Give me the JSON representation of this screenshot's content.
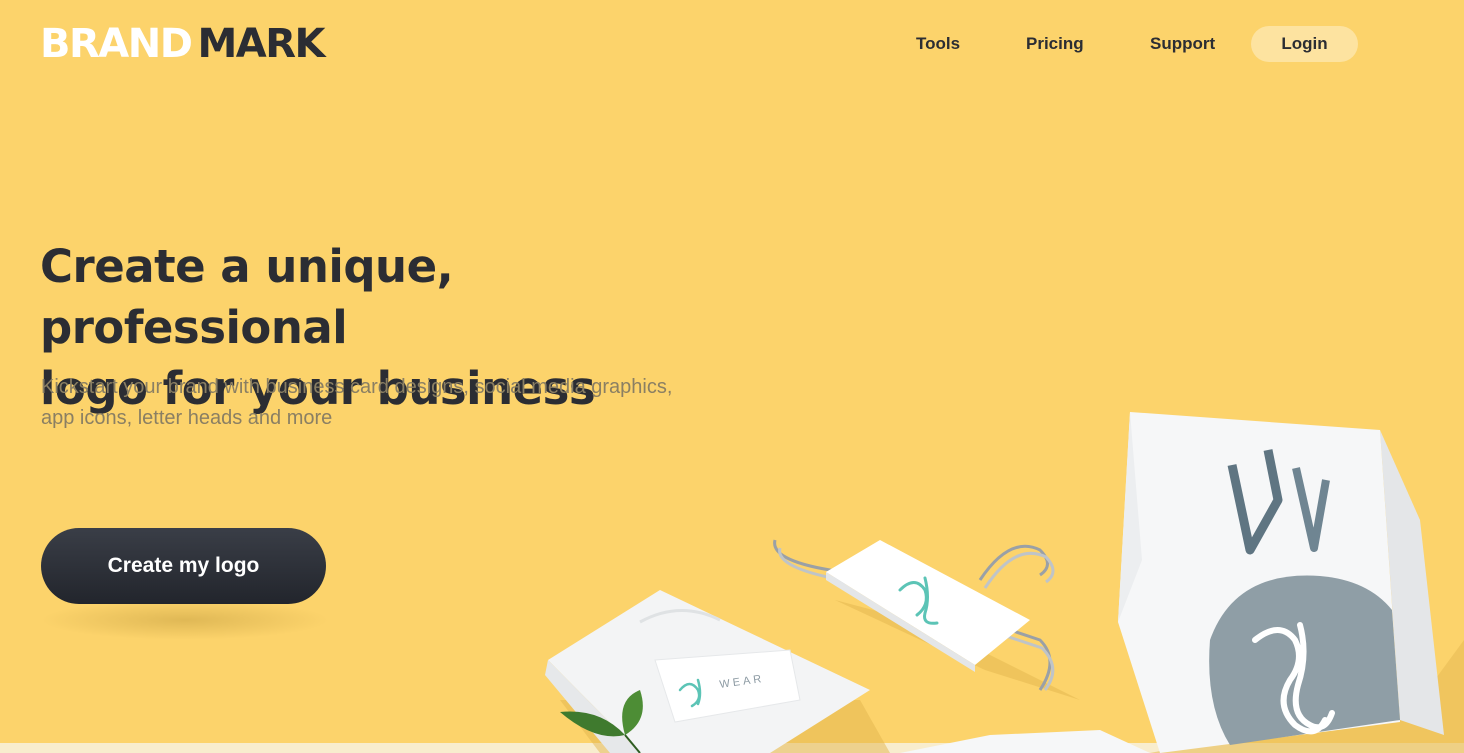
{
  "header": {
    "logo_light": "BRAND",
    "logo_dark": "MARK",
    "nav": {
      "tools": "Tools",
      "pricing": "Pricing",
      "support": "Support",
      "login": "Login"
    }
  },
  "hero": {
    "title_line1": "Create a unique, professional",
    "title_line2": "logo for your business",
    "subtitle_line1": "Kickstart your brand with business card designs, social media graphics,",
    "subtitle_line2": "app icons, letter heads and more",
    "cta": "Create my logo"
  },
  "illustration": {
    "sleeve_brand": "WEAR",
    "items": [
      "folded-tshirt",
      "hanger-box",
      "shopping-bag",
      "leaf"
    ]
  },
  "colors": {
    "background": "#fcd36b",
    "text_dark": "#2b2d33",
    "login_bg": "#fde3a0",
    "cta_bg": "#2b2e35",
    "monogram_teal": "#5cc4b6",
    "bag_circle": "#8f9ea6"
  }
}
